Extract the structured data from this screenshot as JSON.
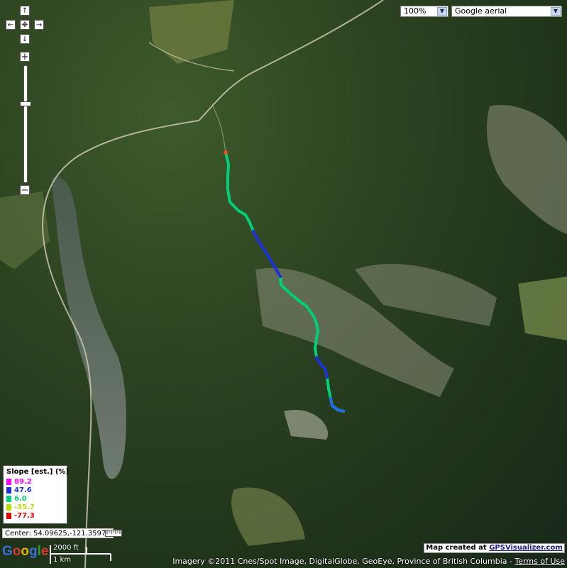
{
  "map": {
    "zoom_select": {
      "value": "100%"
    },
    "maptype_select": {
      "value": "Google aerial"
    }
  },
  "controls": {
    "pan_up": "↑",
    "pan_left": "←",
    "pan_center": "✥",
    "pan_right": "→",
    "pan_down": "↓",
    "zoom_in": "+",
    "zoom_out": "−"
  },
  "legend": {
    "title": "Slope [est.] (%)",
    "items": [
      {
        "value": "89.2",
        "color": "#ff00ff"
      },
      {
        "value": "47.6",
        "color": "#1f2fd8"
      },
      {
        "value": "6.0",
        "color": "#00d07a"
      },
      {
        "value": "-35.7",
        "color": "#b4e000"
      },
      {
        "value": "-77.3",
        "color": "#e00000"
      }
    ]
  },
  "center": {
    "text": "Center: 54.09625,-121.35977"
  },
  "scale": {
    "top_label": "2000 ft",
    "bottom_label": "1 km"
  },
  "credit": {
    "prefix": "Map created at ",
    "link": "GPSVisualizer.com"
  },
  "attribution": {
    "text": "Imagery ©2011 Cnes/Spot Image, DigitalGlobe, GeoEye, Province of British Columbia - ",
    "terms": "Terms of Use"
  },
  "google_logo": {
    "text": "Google"
  },
  "colors": {
    "track_low": "#00d07a",
    "track_high": "#1f2fd8"
  }
}
